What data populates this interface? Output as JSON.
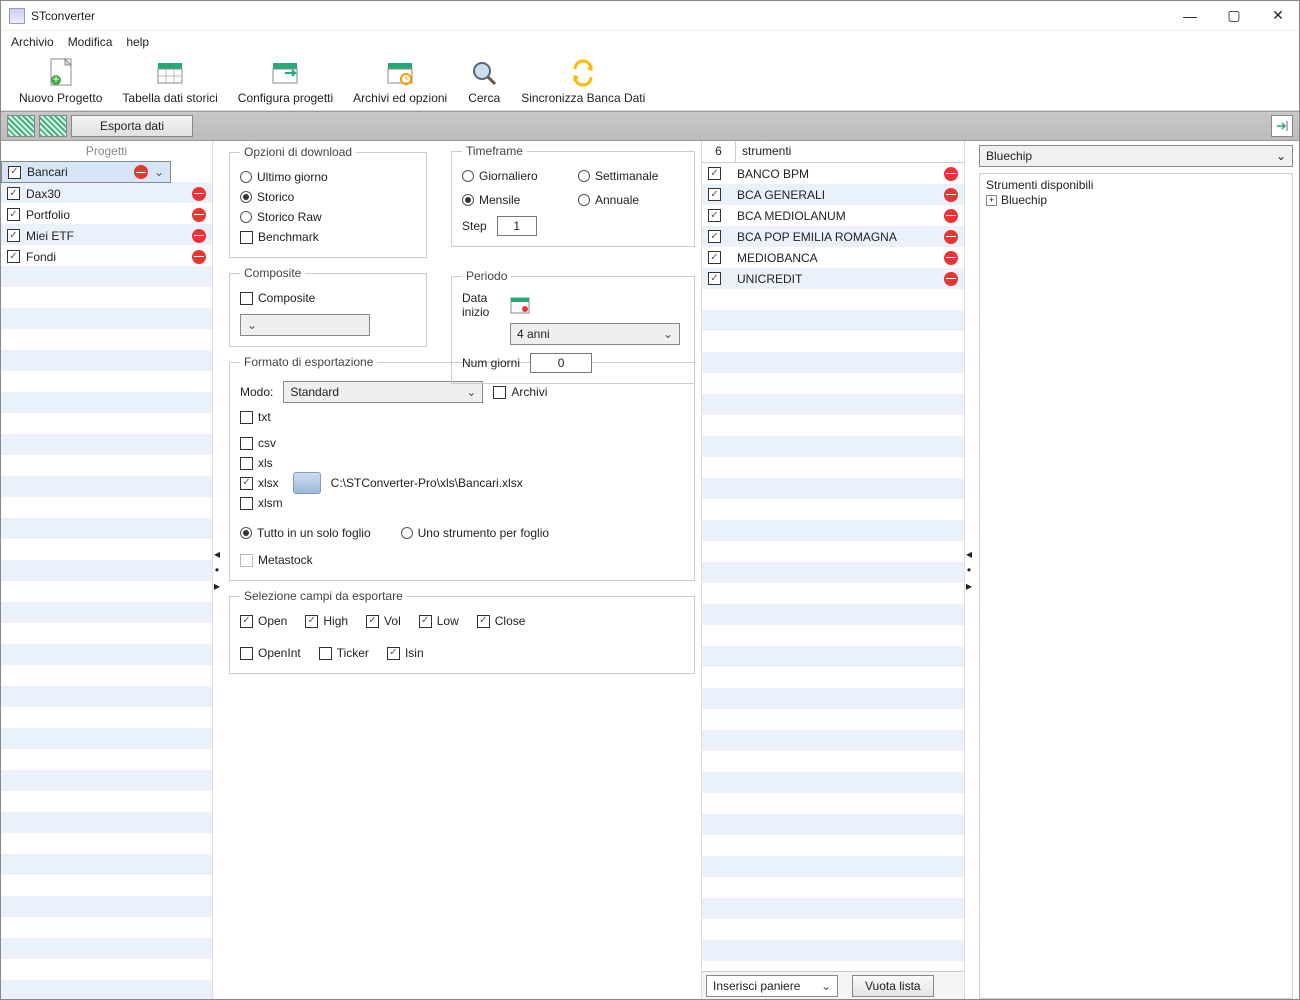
{
  "window": {
    "title": "STconverter"
  },
  "menu": [
    "Archivio",
    "Modifica",
    "help"
  ],
  "toolbar": [
    {
      "label": "Nuovo Progetto",
      "name": "new-project"
    },
    {
      "label": "Tabella dati storici",
      "name": "data-table"
    },
    {
      "label": "Configura progetti",
      "name": "config-projects"
    },
    {
      "label": "Archivi ed opzioni",
      "name": "archives-options"
    },
    {
      "label": "Cerca",
      "name": "search"
    },
    {
      "label": "Sincronizza Banca Dati",
      "name": "sync-db"
    }
  ],
  "secondbar": {
    "export": "Esporta dati"
  },
  "projects": {
    "header": "Progetti",
    "items": [
      {
        "label": "Bancari",
        "selected": true
      },
      {
        "label": "Dax30"
      },
      {
        "label": "Portfolio"
      },
      {
        "label": "Miei ETF"
      },
      {
        "label": "Fondi"
      }
    ]
  },
  "download": {
    "legend": "Opzioni di download",
    "ultimo": "Ultimo giorno",
    "storico": "Storico",
    "raw": "Storico Raw",
    "bench": "Benchmark",
    "selected": "storico"
  },
  "timeframe": {
    "legend": "Timeframe",
    "giornaliero": "Giornaliero",
    "settimanale": "Settimanale",
    "mensile": "Mensile",
    "annuale": "Annuale",
    "selected": "mensile",
    "step_label": "Step",
    "step_value": "1"
  },
  "composite": {
    "legend": "Composite",
    "label": "Composite"
  },
  "periodo": {
    "legend": "Periodo",
    "data_inizio": "Data inizio",
    "range": "4 anni",
    "num_giorni_label": "Num giorni",
    "num_giorni": "0"
  },
  "export": {
    "legend": "Formato di esportazione",
    "modo_label": "Modo:",
    "modo": "Standard",
    "archivi": "Archivi",
    "formats": {
      "txt": "txt",
      "csv": "csv",
      "xls": "xls",
      "xlsx": "xlsx",
      "xlsm": "xlsm"
    },
    "path": "C:\\STConverter-Pro\\xls\\Bancari.xlsx",
    "tutto": "Tutto in un solo foglio",
    "uno": "Uno strumento per foglio",
    "sheet_mode": "tutto",
    "metastock": "Metastock"
  },
  "fields": {
    "legend": "Selezione campi da esportare",
    "open": "Open",
    "high": "High",
    "vol": "Vol",
    "low": "Low",
    "close": "Close",
    "openint": "OpenInt",
    "ticker": "Ticker",
    "isin": "Isin"
  },
  "instruments": {
    "count": "6",
    "label": "strumenti",
    "items": [
      "BANCO BPM",
      "BCA GENERALI",
      "BCA MEDIOLANUM",
      "BCA POP EMILIA ROMAGNA",
      "MEDIOBANCA",
      "UNICREDIT"
    ],
    "insert": "Inserisci paniere",
    "empty": "Vuota lista"
  },
  "right": {
    "combo": "Bluechip",
    "tree_header": "Strumenti disponibili",
    "tree_item": "Bluechip"
  }
}
